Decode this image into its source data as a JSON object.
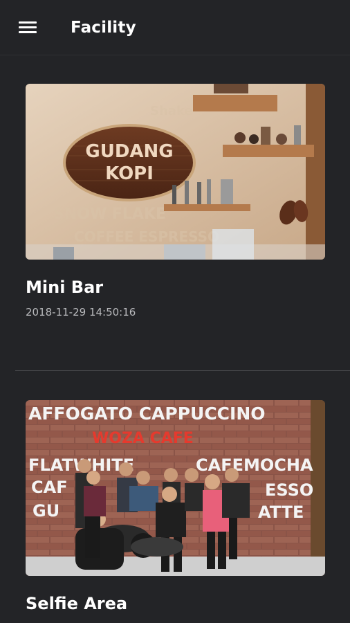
{
  "appbar": {
    "title": "Facility",
    "menu_icon": "menu-icon"
  },
  "facilities": [
    {
      "name": "Mini Bar",
      "date": "2018-11-29 14:50:16",
      "image_sign": [
        "GUDANG",
        "KOPI"
      ]
    },
    {
      "name": "Selfie Area",
      "image_wall_lines": [
        "AFFOGATO CAPPUCCINO",
        "WOZA CAFE",
        "FLATWHITE",
        "CAFEMOCHA",
        "CAF",
        "ESSO",
        "GU",
        "ATTE"
      ]
    }
  ],
  "colors": {
    "background": "#232427",
    "text_primary": "#ffffff",
    "text_secondary": "#b9babd",
    "divider": "#4a4b4e"
  }
}
